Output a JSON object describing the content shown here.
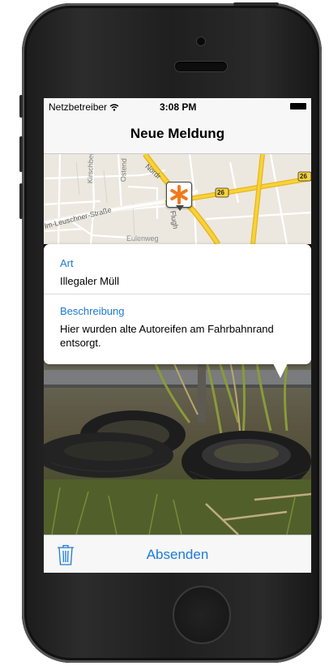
{
  "status_bar": {
    "carrier": "Netzbetreiber",
    "time": "3:08 PM"
  },
  "nav": {
    "title": "Neue Meldung"
  },
  "map": {
    "labels": {
      "kirschberg": "Kirschberg",
      "ostend": "Ostend",
      "nordring": "Nordr",
      "leuschner": "lm-Leuschner-Straße",
      "eulenweg": "Eulenweg",
      "flughafen": "Flugh",
      "route_1": "26",
      "route_2": "26"
    },
    "accent": "#f07a1d"
  },
  "card": {
    "art_label": "Art",
    "art_value": "Illegaler Müll",
    "beschreibung_label": "Beschreibung",
    "beschreibung_value": "Hier wurden alte Autoreifen am Fahrbahnrand entsorgt."
  },
  "toolbar": {
    "send_label": "Absenden"
  },
  "colors": {
    "accent": "#1d7bd6",
    "bar_bg": "#f7f7f7"
  }
}
